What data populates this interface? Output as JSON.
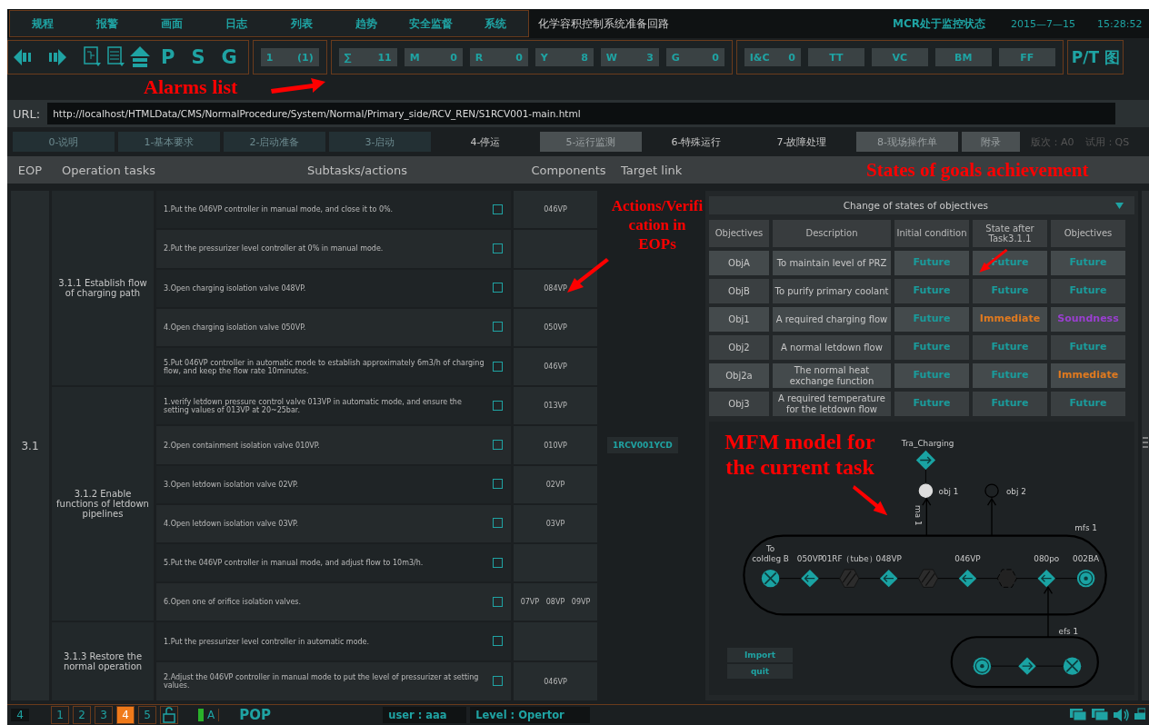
{
  "menu": {
    "items": [
      "规程",
      "报警",
      "画面",
      "日志",
      "列表",
      "趋势",
      "安全监督",
      "系统"
    ],
    "title": "化学容积控制系统准备回路",
    "status": "MCR处于监控状态",
    "date": "2015—7—15",
    "time": "15:28:52"
  },
  "toolbar": {
    "letters": [
      "P",
      "S",
      "G"
    ],
    "page_counter": {
      "label": "1",
      "value": "(1)"
    },
    "alarm_counters": [
      {
        "label": "∑",
        "value": "11"
      },
      {
        "label": "M",
        "value": "0"
      },
      {
        "label": "R",
        "value": "0"
      },
      {
        "label": "Y",
        "value": "8"
      },
      {
        "label": "W",
        "value": "3"
      },
      {
        "label": "G",
        "value": "0"
      }
    ],
    "categories": [
      {
        "label": "I&C",
        "value": "0"
      },
      {
        "label": "TT"
      },
      {
        "label": "VC"
      },
      {
        "label": "BM"
      },
      {
        "label": "FF"
      }
    ],
    "view_button": "P/T 图"
  },
  "url": {
    "label": "URL:",
    "value": "http://localhost/HTMLData/CMS/NormalProcedure/System/Normal/Primary_side/RCV_REN/S1RCV001-main.html"
  },
  "tabs": [
    {
      "label": "0-说明",
      "kind": "dark"
    },
    {
      "label": "1-基本要求",
      "kind": "dark"
    },
    {
      "label": "2-启动准备",
      "kind": "dark"
    },
    {
      "label": "3-启动",
      "kind": "dark"
    },
    {
      "label": "4-停运",
      "kind": "flat"
    },
    {
      "label": "5-运行监测",
      "kind": "light"
    },
    {
      "label": "6-特殊运行",
      "kind": "flat"
    },
    {
      "label": "7-故障处理",
      "kind": "flat"
    },
    {
      "label": "8-现场操作单",
      "kind": "light"
    },
    {
      "label": "附录",
      "kind": "light"
    }
  ],
  "version": "版次：A0",
  "trial": "试用：QS",
  "columns": [
    "EOP",
    "Operation tasks",
    "Subtasks/actions",
    "Components",
    "Target link"
  ],
  "eop": "3.1",
  "tasks": [
    {
      "name": "3.1.1 Establish flow of charging path",
      "actions": [
        {
          "text": "1.Put the 046VP controller in manual mode, and close it to 0%.",
          "checked": false,
          "components": [
            "046VP"
          ]
        },
        {
          "text": "2.Put the pressurizer level controller at 0% in manual mode.",
          "checked": false
        },
        {
          "text": "3.Open charging isolation valve 048VP.",
          "checked": false,
          "components": [
            "084VP"
          ]
        },
        {
          "text": "4.Open charging isolation valve 050VP.",
          "checked": false,
          "components": [
            "050VP"
          ]
        },
        {
          "text": "5.Put 046VP controller in automatic mode to establish approximately 6m3/h of charging flow, and keep the flow rate 10minutes.",
          "checked": false,
          "components": [
            "046VP"
          ]
        }
      ]
    },
    {
      "name": "3.1.2 Enable functions of letdown pipelines",
      "actions": [
        {
          "text": "1.verify letdown pressure control valve 013VP in automatic mode, and ensure the setting values of 013VP at 20~25bar.",
          "checked": false,
          "components": [
            "013VP"
          ]
        },
        {
          "text": "2.Open containment isolation valve 010VP.",
          "checked": false,
          "components": [
            "010VP"
          ],
          "target": "1RCV001YCD"
        },
        {
          "text": "3.Open letdown isolation valve 02VP.",
          "checked": false,
          "components": [
            "02VP"
          ]
        },
        {
          "text": "4.Open letdown isolation valve 03VP.",
          "checked": false,
          "components": [
            "03VP"
          ]
        },
        {
          "text": "5.Put the 046VP controller in manual mode, and adjust flow to 10m3/h.",
          "checked": false
        },
        {
          "text": "6.Open one of orifice isolation valves.",
          "checked": false,
          "components": [
            "07VP",
            "08VP",
            "09VP"
          ]
        }
      ]
    },
    {
      "name": "3.1.3 Restore the normal operation",
      "actions": [
        {
          "text": "1.Put the pressurizer level controller in automatic mode.",
          "checked": false
        },
        {
          "text": "2.Adjust the 046VP controller in manual mode to put the level of pressurizer at setting values.",
          "checked": false,
          "components": [
            "046VP"
          ]
        }
      ]
    }
  ],
  "objectives_panel": {
    "title": "Change of states of objectives",
    "headers": [
      "Objectives",
      "Description",
      "Initial condition",
      "State after Task3.1.1",
      "Objectives"
    ],
    "rows": [
      {
        "id": "ObjA",
        "description": "To maintain level of PRZ",
        "states": [
          {
            "text": "Future",
            "color": "#1a9c9c"
          },
          {
            "text": "Future",
            "color": "#1a9c9c"
          },
          {
            "text": "Future",
            "color": "#1a9c9c"
          }
        ]
      },
      {
        "id": "ObjB",
        "description": "To purify primary coolant",
        "states": [
          {
            "text": "Future",
            "color": "#1a9c9c"
          },
          {
            "text": "Future",
            "color": "#1a9c9c"
          },
          {
            "text": "Future",
            "color": "#1a9c9c"
          }
        ]
      },
      {
        "id": "Obj1",
        "description": "A required charging flow",
        "states": [
          {
            "text": "Future",
            "color": "#1a9c9c"
          },
          {
            "text": "Immediate",
            "color": "#e07a1f"
          },
          {
            "text": "Soundness",
            "color": "#9a3fd0"
          }
        ]
      },
      {
        "id": "Obj2",
        "description": "A normal letdown flow",
        "states": [
          {
            "text": "Future",
            "color": "#1a9c9c"
          },
          {
            "text": "Future",
            "color": "#1a9c9c"
          },
          {
            "text": "Future",
            "color": "#1a9c9c"
          }
        ]
      },
      {
        "id": "Obj2a",
        "description": "The normal heat exchange function",
        "states": [
          {
            "text": "Future",
            "color": "#1a9c9c"
          },
          {
            "text": "Future",
            "color": "#1a9c9c"
          },
          {
            "text": "Immediate",
            "color": "#e07a1f"
          }
        ]
      },
      {
        "id": "Obj3",
        "description": "A required temperature for the letdown flow",
        "states": [
          {
            "text": "Future",
            "color": "#1a9c9c"
          },
          {
            "text": "Future",
            "color": "#1a9c9c"
          },
          {
            "text": "Future",
            "color": "#1a9c9c"
          }
        ]
      }
    ]
  },
  "mfm": {
    "top_function": "Tra_Charging",
    "objectives": [
      {
        "label": "obj 1",
        "achieved": true
      },
      {
        "label": "obj 2",
        "achieved": false
      }
    ],
    "relation": "ma 1",
    "main_structure": {
      "label": "mfs 1",
      "nodes": [
        {
          "kind": "sink",
          "label": [
            "To",
            "coldleg B"
          ]
        },
        {
          "kind": "transport",
          "label": [
            "050VP"
          ]
        },
        {
          "kind": "barrier",
          "label": [
            "01RF（tube）"
          ]
        },
        {
          "kind": "transport",
          "label": [
            "048VP"
          ]
        },
        {
          "kind": "barrier"
        },
        {
          "kind": "transport",
          "label": [
            "046VP"
          ]
        },
        {
          "kind": "balance"
        },
        {
          "kind": "transport",
          "label": [
            "080po"
          ]
        },
        {
          "kind": "source",
          "label": [
            "002BA"
          ]
        }
      ]
    },
    "energy_structure": {
      "label": "efs 1",
      "nodes": [
        {
          "kind": "source"
        },
        {
          "kind": "transport"
        },
        {
          "kind": "sink"
        }
      ]
    }
  },
  "actions": [
    "Import",
    "quit"
  ],
  "status_bar": {
    "screen": "4",
    "pages": [
      {
        "label": "1",
        "selected": false
      },
      {
        "label": "2",
        "selected": false
      },
      {
        "label": "3",
        "selected": false
      },
      {
        "label": "4",
        "selected": true
      },
      {
        "label": "5",
        "selected": false
      }
    ],
    "mode": "A",
    "mode_name": "POP",
    "user": "user : aaa",
    "level": "Level : Opertor"
  },
  "annotations": [
    "Alarms list",
    "States of goals achievement",
    "Actions/Verification in EOPs",
    "MFM model for the current task"
  ]
}
